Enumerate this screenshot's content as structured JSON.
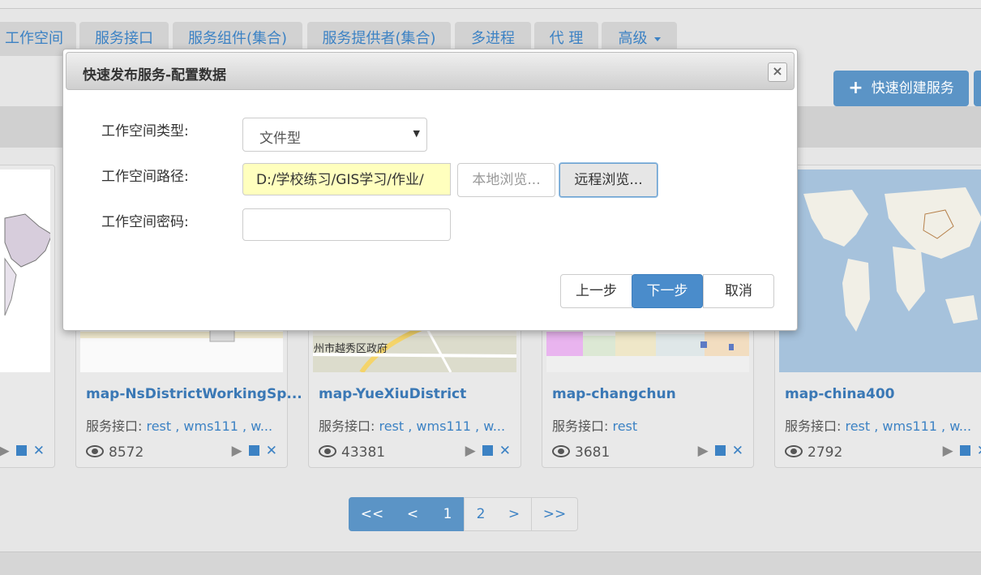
{
  "nav": {
    "tabs": [
      {
        "label": "工作空间"
      },
      {
        "label": "服务接口"
      },
      {
        "label": "服务组件(集合)"
      },
      {
        "label": "服务提供者(集合)"
      },
      {
        "label": "多进程"
      },
      {
        "label": "代 理"
      },
      {
        "label": "高级"
      }
    ]
  },
  "toolbar": {
    "quick_create_label": "快速创建服务"
  },
  "cards": [
    {
      "title": "",
      "api_label": "",
      "api_links": "",
      "views": ""
    },
    {
      "title": "map-NsDistrictWorkingSp...",
      "api_label": "服务接口: ",
      "api_links": "rest , wms111 , w...",
      "views": "8572"
    },
    {
      "title": "map-YueXiuDistrict",
      "api_label": "服务接口: ",
      "api_links": "rest , wms111 , w...",
      "views": "43381",
      "map_text": "州市越秀区政府"
    },
    {
      "title": "map-changchun",
      "api_label": "服务接口: ",
      "api_links": "rest",
      "views": "3681"
    },
    {
      "title": "map-china400",
      "api_label": "服务接口: ",
      "api_links": "rest , wms111 , w...",
      "views": "2792"
    }
  ],
  "pager": {
    "first": "<<",
    "prev": "<",
    "page1": "1",
    "page2": "2",
    "next": ">",
    "last": ">>"
  },
  "modal": {
    "title": "快速发布服务-配置数据",
    "close": "×",
    "type_label": "工作空间类型:",
    "type_value": "文件型",
    "path_label": "工作空间路径:",
    "path_value": "D:/学校练习/GIS学习/作业/",
    "local_browse": "本地浏览...",
    "remote_browse": "远程浏览...",
    "password_label": "工作空间密码:",
    "prev_button": "上一步",
    "next_button": "下一步",
    "cancel_button": "取消"
  },
  "colors": {
    "accent": "#4a8ccb",
    "link": "#3c82c4",
    "path_bg": "#ffffbe"
  }
}
